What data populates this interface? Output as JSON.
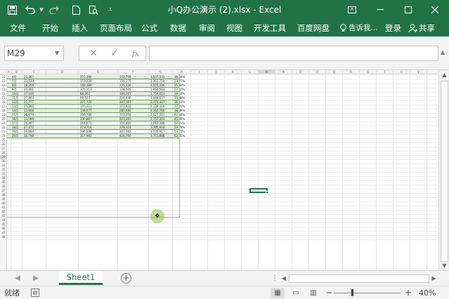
{
  "app": {
    "title": "小Q办公演示 (2).xlsx - Excel",
    "quick_access": [
      "save-icon",
      "undo-icon",
      "redo-icon",
      "new-file-icon",
      "print-preview-icon",
      "customize-icon"
    ]
  },
  "window_controls": {
    "ribbon_options": "▭",
    "minimize": "—",
    "maximize": "☐",
    "close": "✕"
  },
  "ribbon": {
    "tabs": [
      "文件",
      "开始",
      "插入",
      "页面布局",
      "公式",
      "数据",
      "审阅",
      "视图",
      "开发工具",
      "百度网盘"
    ],
    "tell_me": "告诉我...",
    "login": "登录",
    "share": "共享"
  },
  "formula_bar": {
    "name_box": "M29",
    "cancel_icon": "cancel-icon",
    "enter_icon": "enter-icon",
    "fx_label": "fx",
    "formula": ""
  },
  "grid": {
    "columns": [
      "A",
      "B",
      "C",
      "D",
      "E",
      "F",
      "G",
      "H",
      "I",
      "J",
      "K",
      "L",
      "M",
      "N",
      "O",
      "P",
      "Q",
      "R",
      "S",
      "T",
      "U",
      "V"
    ],
    "first_row": 10,
    "last_row": 48,
    "selected_cell": "M29",
    "table_rows": [
      [
        "4月",
        "23,267",
        "",
        "253,366",
        "152,709",
        "1,537,531",
        "16.59%"
      ],
      [
        "7月",
        "33,533",
        "",
        "353,228",
        "156,275",
        "1,363,759",
        "23.71%"
      ],
      [
        "8月",
        "18,259",
        "",
        "182,389",
        "135,536",
        "1,555,336",
        "25.93%"
      ],
      [
        "9月",
        "23,301",
        "",
        "375,313",
        "178,505",
        "1,650,563",
        "27.47%"
      ],
      [
        "10月",
        "17,326",
        "",
        "88,262",
        "196,561",
        "1,759,613",
        "39.16%"
      ],
      [
        "11月",
        "27,803",
        "",
        "69,527",
        "224,646",
        "1,848,637",
        "30.80%"
      ],
      [
        "12月",
        "22,777",
        "",
        "227,770",
        "247,161",
        "2,076,407",
        "36.61%"
      ],
      [
        "13月",
        "25,360",
        "",
        "155,311",
        "272,832",
        "2,139,318",
        "37.25%"
      ],
      [
        "14月",
        "13,668",
        "",
        "138,077",
        "285,680",
        "2,360,766",
        "38.39%"
      ],
      [
        "15月",
        "26,679",
        "",
        "266,786",
        "310,358",
        "2,627,561",
        "42.66%"
      ],
      [
        "16月",
        "13,080",
        "",
        "130,867",
        "323,393",
        "2,757,303",
        "45.80%"
      ],
      [
        "17月",
        "26,467",
        "",
        "264,671",
        "350,860",
        "3,012,388",
        "50.21%"
      ],
      [
        "18月",
        "27,372",
        "",
        "273,714",
        "378,123",
        "3,385,918",
        "54.78%"
      ],
      [
        "19月",
        "29,660",
        "",
        "296,606",
        "407,362",
        "3,535,917",
        "53.73%"
      ],
      [
        "20月",
        "16,798",
        "",
        "167,981",
        "426,760",
        "3,751,888",
        "62.35%"
      ]
    ]
  },
  "sheets": {
    "active": "Sheet1",
    "add_label": "+"
  },
  "status": {
    "ready": "就绪",
    "zoom": "40%",
    "zoom_value": 0.4,
    "minus": "−",
    "plus": "+"
  }
}
